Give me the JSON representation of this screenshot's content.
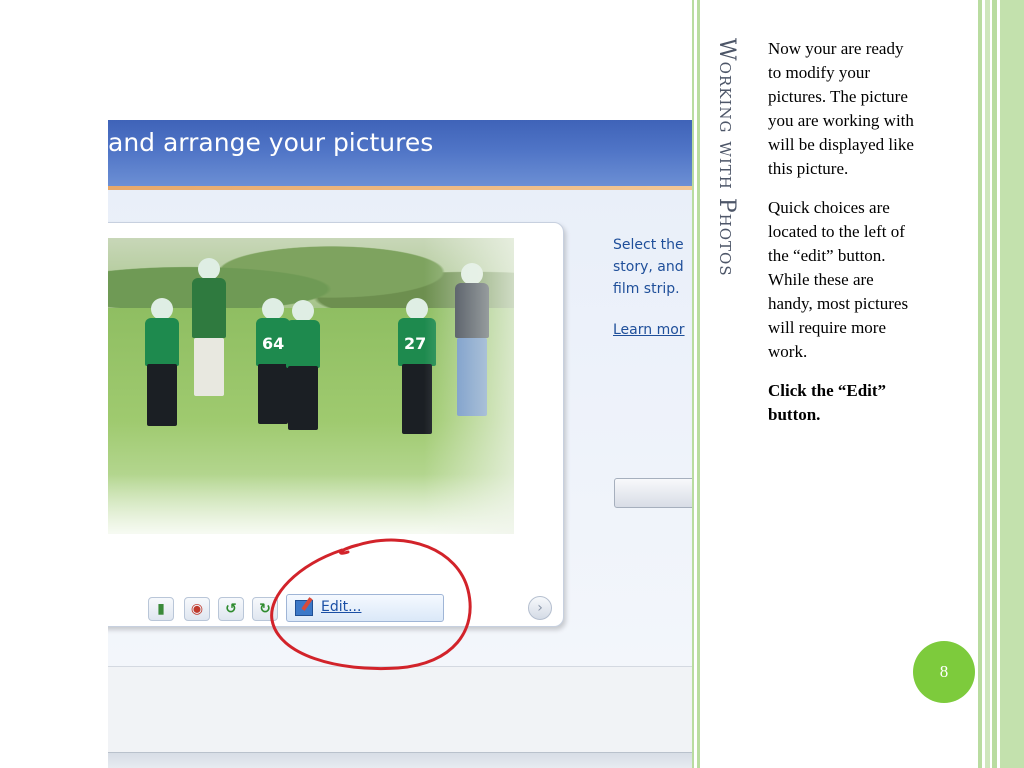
{
  "slide": {
    "title": "Working with Photos",
    "paragraphs": [
      "Now your are ready to modify your pictures. The picture you are working with will be displayed like this picture.",
      "Quick choices are located to the left of the “edit” button. While these are handy, most pictures will require more work."
    ],
    "emphasis": "Click the “Edit” button.",
    "page_number": "8"
  },
  "screenshot": {
    "header_text": "and arrange your pictures",
    "side_text": "Select the story, and film strip.",
    "side_link": "Learn mor",
    "edit_button_label": "Edit...",
    "toolbar_icons": [
      "auto-adjust-icon",
      "red-eye-icon",
      "rotate-left-icon",
      "rotate-right-icon"
    ],
    "jersey_numbers": [
      "64",
      "27"
    ]
  },
  "colors": {
    "accent_green": "#7dcb3c",
    "stripe_green": "#b9dca0",
    "annotation_red": "#d2232a",
    "header_blue": "#4f74c6"
  }
}
